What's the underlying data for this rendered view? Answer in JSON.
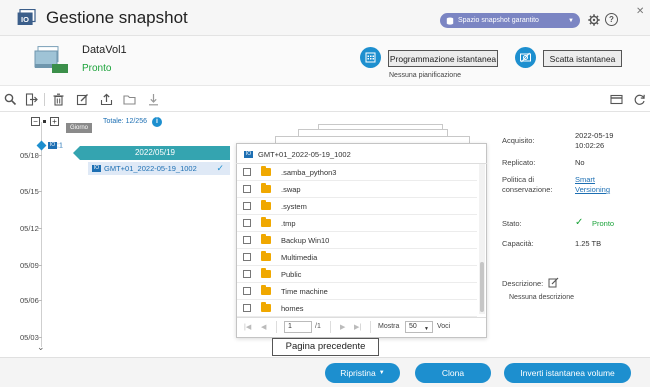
{
  "header": {
    "title": "Gestione snapshot",
    "space_button": "Spazio snapshot garantito"
  },
  "volume": {
    "name": "DataVol1",
    "status": "Pronto",
    "schedule_button": "Programmazione istantanea",
    "schedule_note": "Nessuna pianificazione",
    "take_snapshot_button": "Scatta istantanea"
  },
  "timeline": {
    "zoom_minus": "−",
    "zoom_plus": "+",
    "zoom_level_badge": "Giorno",
    "total": "Totale: 12/256",
    "marker_count": ":1",
    "dates": [
      "05/18",
      "05/15",
      "05/12",
      "05/09",
      "05/06",
      "05/03"
    ],
    "day_header": "2022/05/19",
    "snapshot_name": "GMT+01_2022-05-19_1002"
  },
  "file_popup": {
    "title": "GMT+01_2022-05-19_1002",
    "files": [
      ".samba_python3",
      ".swap",
      ".system",
      ".tmp",
      "Backup Win10",
      "Multimedia",
      "Public",
      "Time machine",
      "homes"
    ],
    "page": "1",
    "page_total": "/1",
    "show_label": "Mostra",
    "per_page": "50",
    "items_label": "Voci"
  },
  "tooltip": "Pagina precedente",
  "details": {
    "acquired_label": "Acquisito:",
    "acquired_value_date": "2022-05-19",
    "acquired_value_time": "10:02:26",
    "replicated_label": "Replicato:",
    "replicated_value": "No",
    "policy_label_1": "Politica di",
    "policy_label_2": "conservazione:",
    "policy_value_1": "Smart",
    "policy_value_2": "Versioning",
    "state_label": "Stato:",
    "state_value": "Pronto",
    "capacity_label": "Capacità:",
    "capacity_value": "1.25 TB",
    "description_label": "Descrizione:",
    "description_value": "Nessuna descrizione"
  },
  "footer": {
    "restore_button": "Ripristina",
    "clone_button": "Clona",
    "revert_button": "Inverti istantanea volume"
  },
  "colors": {
    "accent": "#1d8fcf",
    "day_header": "#34a4b0",
    "status_green": "#1ba33a",
    "space_pill": "#7b85c3"
  }
}
